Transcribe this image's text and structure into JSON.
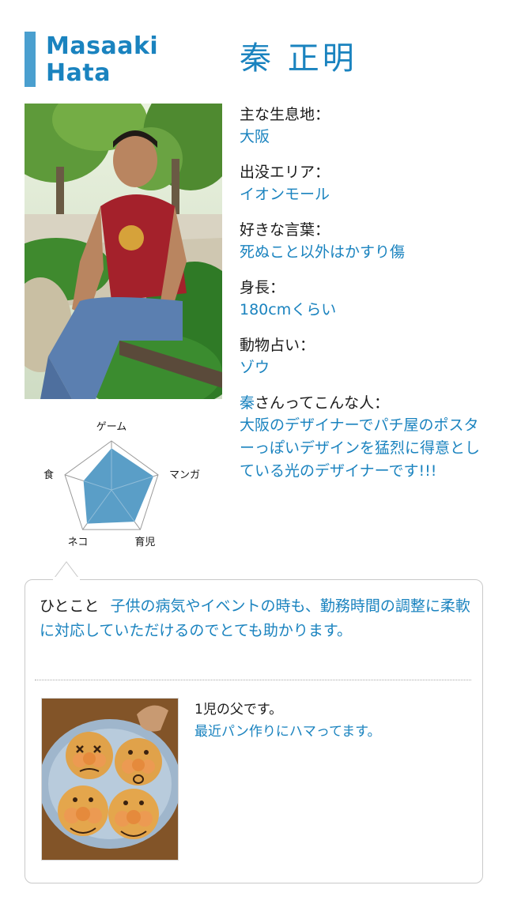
{
  "header": {
    "name_en_line1": "Masaaki",
    "name_en_line2": "Hata",
    "name_jp": "秦 正明"
  },
  "profile": [
    {
      "label": "主な生息地：",
      "value": "大阪"
    },
    {
      "label": "出没エリア：",
      "value": "イオンモール"
    },
    {
      "label": "好きな言葉：",
      "value": "死ぬこと以外はかすり傷"
    },
    {
      "label": "身長：",
      "value": "180cmくらい"
    },
    {
      "label": "動物占い：",
      "value": "ゾウ"
    }
  ],
  "about": {
    "label_prefix": "秦",
    "label_rest": "さんってこんな人：",
    "value": "大阪のデザイナーでパチ屋のポスターっぽいデザインを猛烈に得意としている光のデザイナーです!!!"
  },
  "radar": {
    "axes": [
      "ゲーム",
      "マンガ",
      "育児",
      "ネコ",
      "食"
    ],
    "values": [
      0.85,
      0.9,
      0.8,
      0.85,
      0.6
    ],
    "fill_color": "#5a9ec7",
    "grid_color": "#9a9a9a"
  },
  "comment": {
    "label": "ひとこと",
    "text": "子供の病気やイベントの時も、勤務時間の調整に柔軟に対応していただけるのでとても助かります。"
  },
  "family": {
    "line1": "1児の父です。",
    "line2": "最近パン作りにハマってます。"
  },
  "colors": {
    "accent": "#1a83bf",
    "bar": "#4a9fcf"
  }
}
